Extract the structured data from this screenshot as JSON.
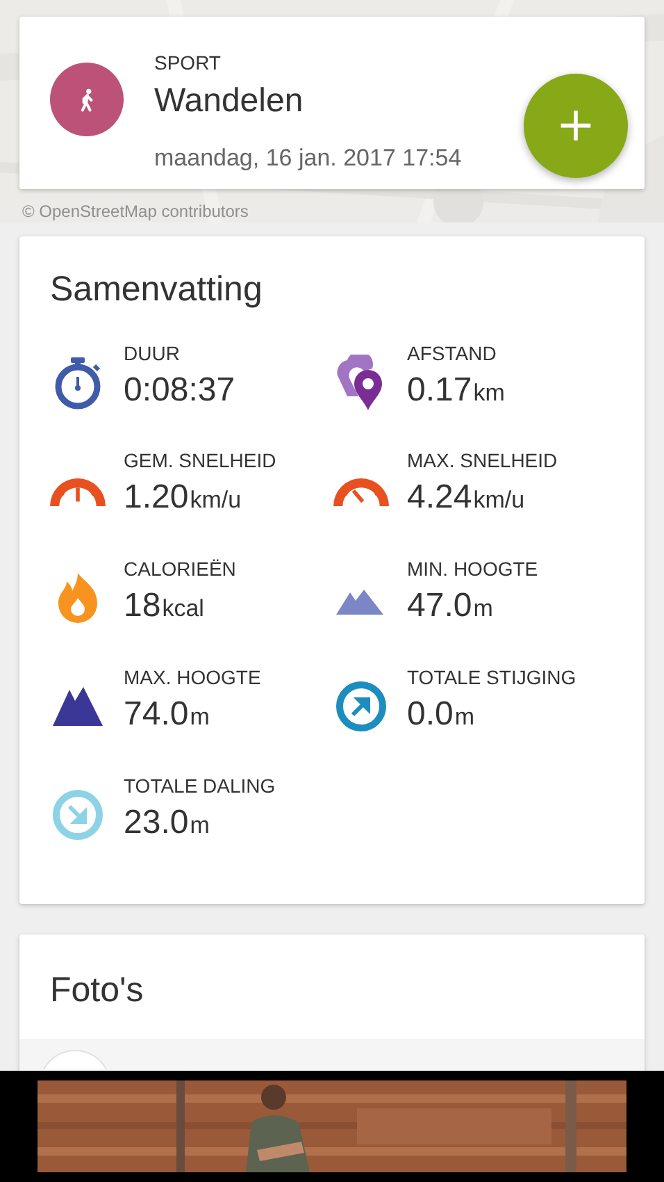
{
  "activity": {
    "label": "SPORT",
    "name": "Wandelen",
    "datetime": "maandag, 16 jan. 2017 17:54",
    "add_button": "+"
  },
  "map": {
    "kind": "picture",
    "attribution": "© OpenStreetMap contributors"
  },
  "summary": {
    "title": "Samenvatting",
    "stats": [
      {
        "kind": "duration",
        "label": "DUUR",
        "value": "0:08:37"
      },
      {
        "kind": "distance",
        "label": "AFSTAND",
        "value": "0.17",
        "unit": "km"
      },
      {
        "kind": "avg-speed",
        "label": "GEM. SNELHEID",
        "value": "1.20",
        "unit": "km/u"
      },
      {
        "kind": "max-speed",
        "label": "MAX. SNELHEID",
        "value": "4.24",
        "unit": "km/u"
      },
      {
        "kind": "calories",
        "label": "CALORIEËN",
        "value": "18",
        "unit": "kcal"
      },
      {
        "kind": "min-altitude",
        "label": "MIN. HOOGTE",
        "value": "47.0",
        "unit": "m"
      },
      {
        "kind": "max-altitude",
        "label": "MAX. HOOGTE",
        "value": "74.0",
        "unit": "m"
      },
      {
        "kind": "ascent",
        "label": "TOTALE STIJGING",
        "value": "0.0",
        "unit": "m"
      },
      {
        "kind": "descent",
        "label": "TOTALE DALING",
        "value": "23.0",
        "unit": "m"
      }
    ]
  },
  "photos": {
    "title": "Foto's"
  }
}
